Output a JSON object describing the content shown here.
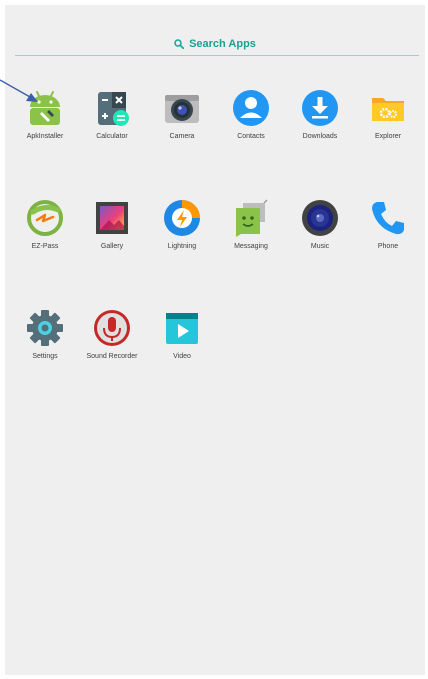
{
  "search": {
    "label": "Search Apps"
  },
  "apps": [
    {
      "label": "ApkInstaller",
      "icon": "android-installer-icon"
    },
    {
      "label": "Calculator",
      "icon": "calculator-icon"
    },
    {
      "label": "Camera",
      "icon": "camera-icon"
    },
    {
      "label": "Contacts",
      "icon": "contacts-icon"
    },
    {
      "label": "Downloads",
      "icon": "downloads-icon"
    },
    {
      "label": "Explorer",
      "icon": "folder-gear-icon"
    },
    {
      "label": "EZ-Pass",
      "icon": "ez-pass-icon"
    },
    {
      "label": "Gallery",
      "icon": "gallery-icon"
    },
    {
      "label": "Lightning",
      "icon": "lightning-browser-icon"
    },
    {
      "label": "Messaging",
      "icon": "messaging-icon"
    },
    {
      "label": "Music",
      "icon": "music-speaker-icon"
    },
    {
      "label": "Phone",
      "icon": "phone-icon"
    },
    {
      "label": "Settings",
      "icon": "settings-gear-icon"
    },
    {
      "label": "Sound Recorder",
      "icon": "microphone-icon"
    },
    {
      "label": "Video",
      "icon": "video-play-icon"
    }
  ],
  "colors": {
    "accent": "#17a294",
    "background": "#efefef",
    "annotation": "#3a5fa8"
  }
}
